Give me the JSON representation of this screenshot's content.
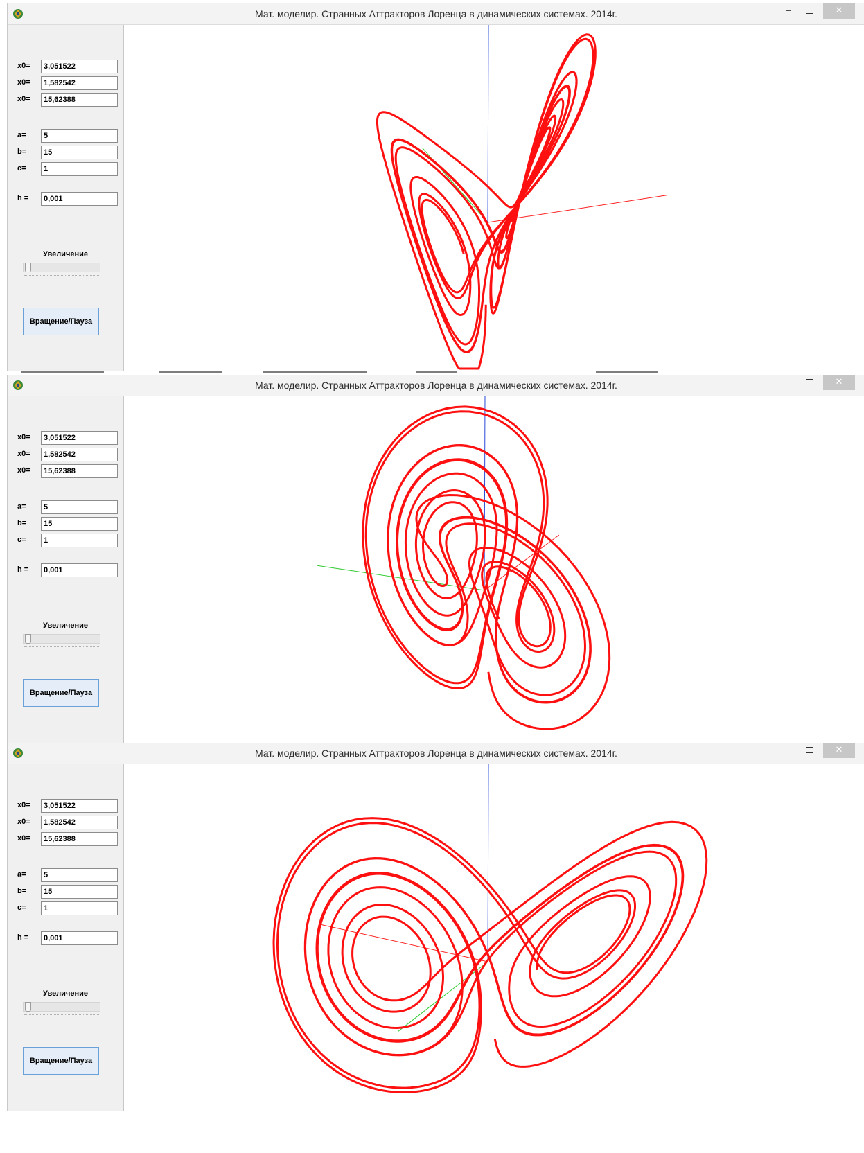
{
  "windows": [
    {
      "title": "Мат. моделир. Странных Аттракторов Лоренца в динамических системах.   2014г.",
      "fields": [
        {
          "label": "x0=",
          "value": "3,051522"
        },
        {
          "label": "x0=",
          "value": "1,582542"
        },
        {
          "label": "x0=",
          "value": "15,62388"
        },
        {
          "label": "a=",
          "value": "5"
        },
        {
          "label": "b=",
          "value": "15"
        },
        {
          "label": "c=",
          "value": "1"
        },
        {
          "label": "h =",
          "value": "0,001"
        }
      ],
      "zoom_label": "Увеличение",
      "zoom_value": 0,
      "button_label": "Вращение/Пауза",
      "view": "left-lobe-front"
    },
    {
      "title": "Мат. моделир. Странных Аттракторов Лоренца в динамических системах.   2014г.",
      "fields": [
        {
          "label": "x0=",
          "value": "3,051522"
        },
        {
          "label": "x0=",
          "value": "1,582542"
        },
        {
          "label": "x0=",
          "value": "15,62388"
        },
        {
          "label": "a=",
          "value": "5"
        },
        {
          "label": "b=",
          "value": "15"
        },
        {
          "label": "c=",
          "value": "1"
        },
        {
          "label": "h =",
          "value": "0,001"
        }
      ],
      "zoom_label": "Увеличение",
      "zoom_value": 0,
      "button_label": "Вращение/Пауза",
      "view": "rotated-mid"
    },
    {
      "title": "Мат. моделир. Странных Аттракторов Лоренца в динамических системах.   2014г.",
      "fields": [
        {
          "label": "x0=",
          "value": "3,051522"
        },
        {
          "label": "x0=",
          "value": "1,582542"
        },
        {
          "label": "x0=",
          "value": "15,62388"
        },
        {
          "label": "a=",
          "value": "5"
        },
        {
          "label": "b=",
          "value": "15"
        },
        {
          "label": "c=",
          "value": "1"
        },
        {
          "label": "h =",
          "value": "0,001"
        }
      ],
      "zoom_label": "Увеличение",
      "zoom_value": 0,
      "button_label": "Вращение/Пауза",
      "view": "right-lobe-front"
    }
  ],
  "colors": {
    "trajectory": "#ff1010",
    "axis_x": "#ff2020",
    "axis_y": "#33cc33",
    "axis_z": "#2a4bd8",
    "window_frame": "#f0f0f0",
    "title_bar": "#f3f3f3",
    "button_border": "#6aa0d8"
  },
  "icons": [
    "app-icon",
    "minimize-icon",
    "maximize-icon",
    "close-icon"
  ]
}
